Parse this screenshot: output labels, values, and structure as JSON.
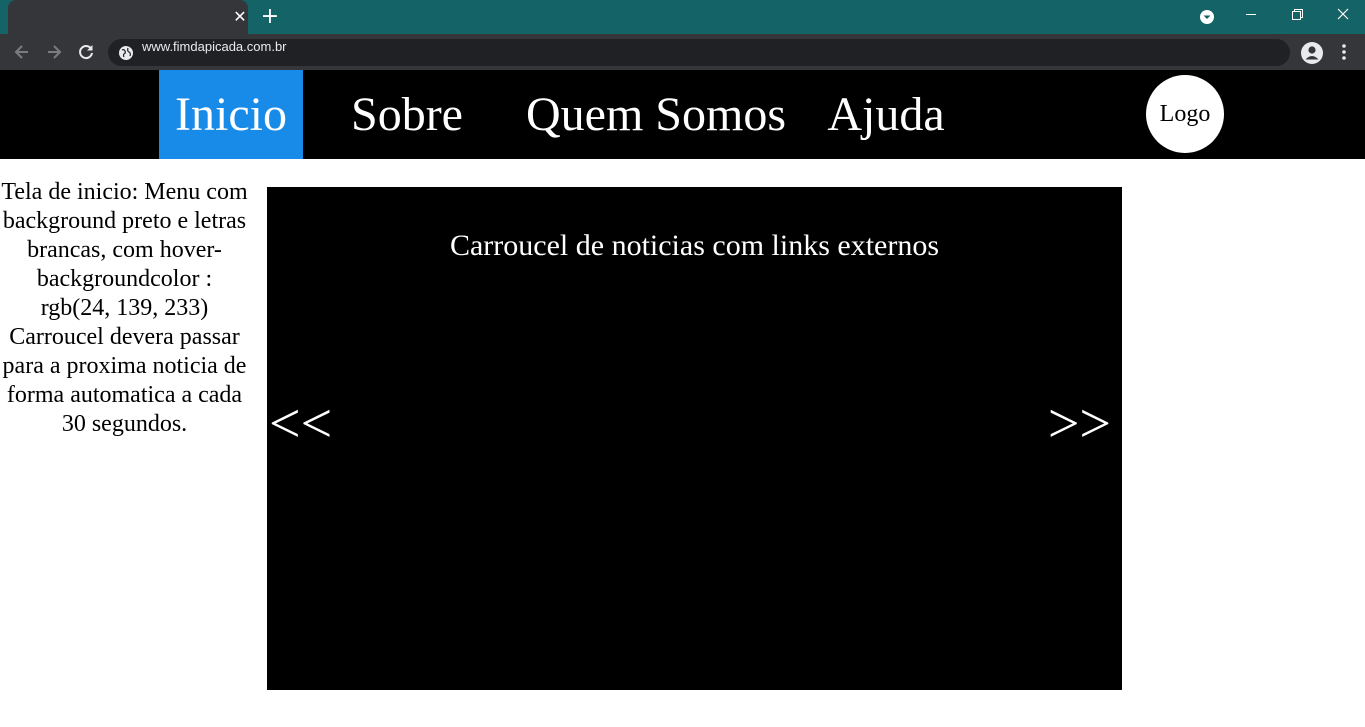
{
  "browser": {
    "tab": {
      "close_glyph": "✕",
      "title": ""
    },
    "new_tab_glyph": "+",
    "address": {
      "url": "www.fimdapicada.com.br"
    },
    "icons": [
      "back-icon",
      "forward-icon",
      "reload-icon",
      "globe-icon",
      "account-icon",
      "kebab-menu-icon",
      "tab-search-icon",
      "minimize-icon",
      "restore-icon",
      "close-window-icon"
    ],
    "colors": {
      "titlebar": "#146367",
      "toolbar": "#35363a",
      "omnibox": "#202124"
    }
  },
  "navbar": {
    "items": [
      {
        "label": "Inicio",
        "active": true
      },
      {
        "label": "Sobre",
        "active": false
      },
      {
        "label": "Quem Somos",
        "active": false
      },
      {
        "label": "Ajuda",
        "active": false
      }
    ],
    "logo_label": "Logo",
    "colors": {
      "background": "#000000",
      "text": "#ffffff",
      "active_background": "#188be9"
    }
  },
  "description": {
    "text": "Tela de inicio: Menu com background preto e letras brancas, com hover-backgroundcolor : rgb(24, 139, 233) Carroucel devera passar para a proxima noticia de forma automatica a cada 30 segundos."
  },
  "carousel": {
    "title": "Carroucel de noticias com links externos",
    "prev_label": "<<",
    "next_label": ">>",
    "colors": {
      "background": "#000000",
      "text": "#ffffff"
    }
  }
}
